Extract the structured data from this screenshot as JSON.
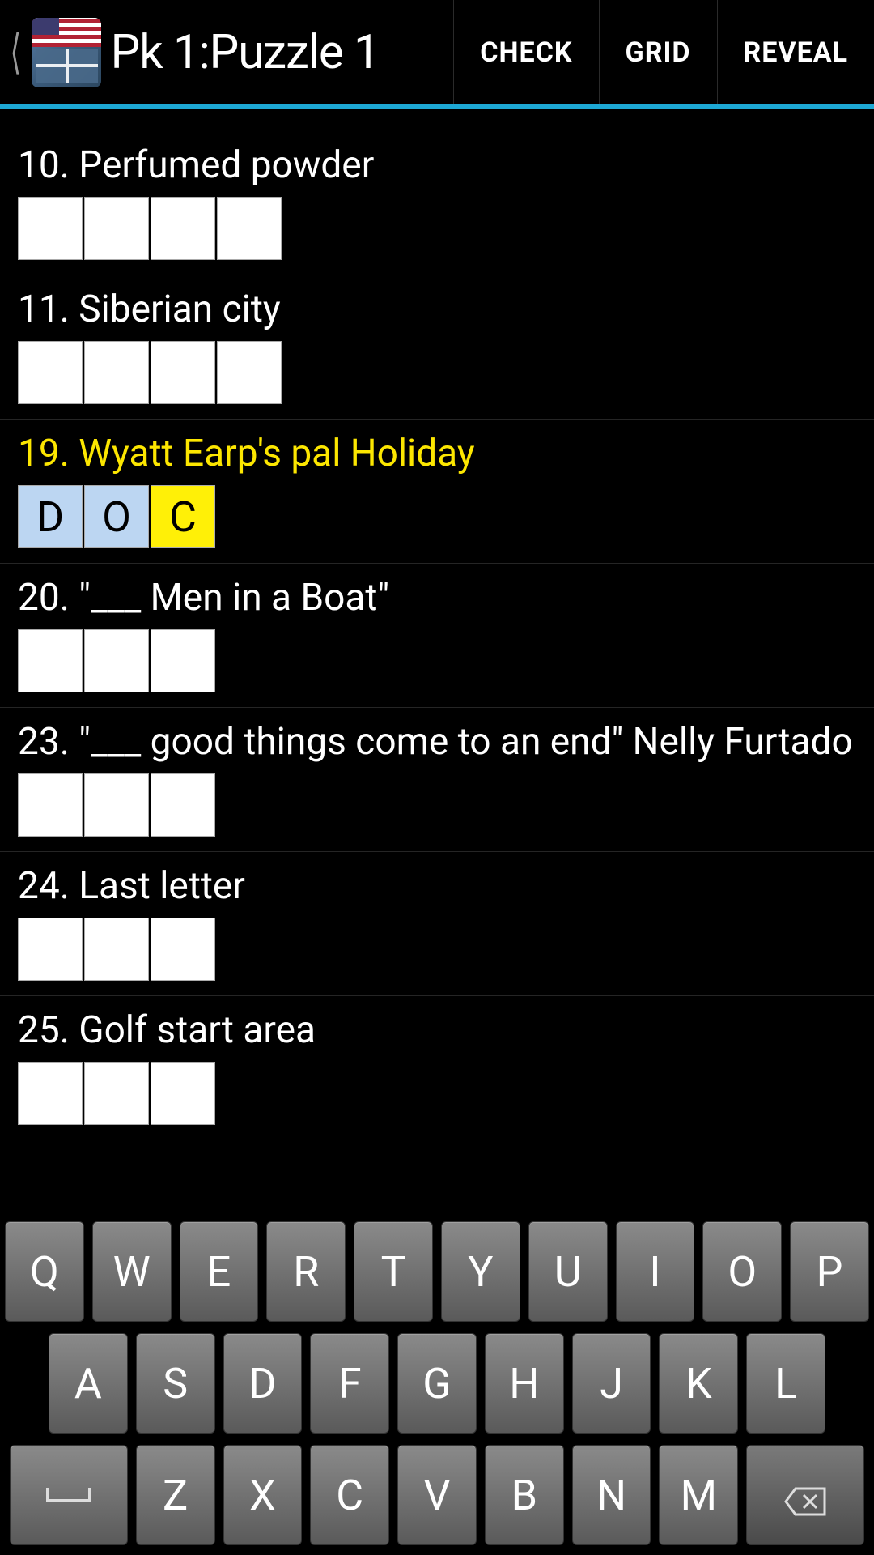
{
  "header": {
    "title": "Pk 1:Puzzle 1",
    "actions": {
      "check": "CHECK",
      "grid": "GRID",
      "reveal": "REVEAL"
    }
  },
  "clues": [
    {
      "num": "10",
      "text": "Perfumed powder",
      "len": 4,
      "cells": [
        "",
        "",
        "",
        ""
      ],
      "active": false
    },
    {
      "num": "11",
      "text": "Siberian city",
      "len": 4,
      "cells": [
        "",
        "",
        "",
        ""
      ],
      "active": false
    },
    {
      "num": "19",
      "text": "Wyatt Earp's pal Holiday",
      "len": 3,
      "cells": [
        "D",
        "O",
        "C"
      ],
      "active": true,
      "cursor": 2
    },
    {
      "num": "20",
      "text": "\"___ Men in a Boat\"",
      "len": 3,
      "cells": [
        "",
        "",
        ""
      ],
      "active": false
    },
    {
      "num": "23",
      "text": "\"___ good things come to an end\" Nelly Furtado",
      "len": 3,
      "cells": [
        "",
        "",
        ""
      ],
      "active": false
    },
    {
      "num": "24",
      "text": "Last letter",
      "len": 3,
      "cells": [
        "",
        "",
        ""
      ],
      "active": false
    },
    {
      "num": "25",
      "text": "Golf start area",
      "len": 3,
      "cells": [
        "",
        "",
        ""
      ],
      "active": false
    }
  ],
  "keyboard": {
    "row1": [
      "Q",
      "W",
      "E",
      "R",
      "T",
      "Y",
      "U",
      "I",
      "O",
      "P"
    ],
    "row2": [
      "A",
      "S",
      "D",
      "F",
      "G",
      "H",
      "J",
      "K",
      "L"
    ],
    "row3": [
      "Z",
      "X",
      "C",
      "V",
      "B",
      "N",
      "M"
    ]
  }
}
